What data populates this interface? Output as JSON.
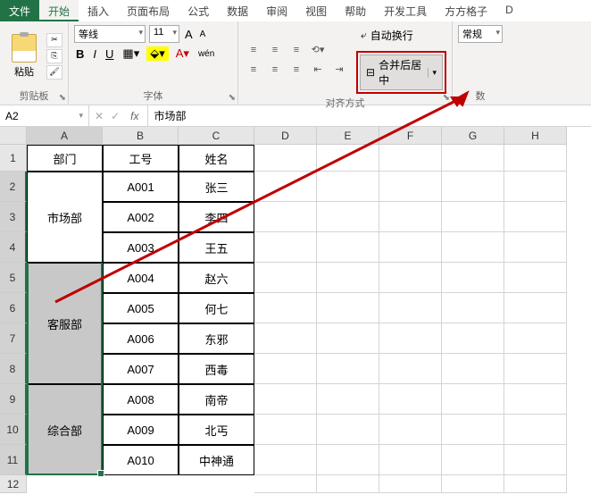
{
  "tabs": {
    "file": "文件",
    "home": "开始",
    "insert": "插入",
    "layout": "页面布局",
    "formula": "公式",
    "data": "数据",
    "review": "审阅",
    "view": "视图",
    "help": "帮助",
    "dev": "开发工具",
    "ffgz": "方方格子",
    "d": "D"
  },
  "clipboard": {
    "paste": "粘贴",
    "label": "剪贴板"
  },
  "font": {
    "name": "等线",
    "size": "11",
    "bold": "B",
    "italic": "I",
    "underline": "U",
    "wen": "wén",
    "aa_big": "A",
    "aa_small": "A",
    "label": "字体"
  },
  "align": {
    "wrap": "自动换行",
    "merge": "合并后居中",
    "label": "对齐方式"
  },
  "number": {
    "general": "常规",
    "label": "数"
  },
  "namebox": "A2",
  "formula_value": "市场部",
  "cols": [
    "A",
    "B",
    "C",
    "D",
    "E",
    "F",
    "G",
    "H"
  ],
  "rows": [
    "1",
    "2",
    "3",
    "4",
    "5",
    "6",
    "7",
    "8",
    "9",
    "10",
    "11",
    "12"
  ],
  "table": {
    "header": {
      "dept": "部门",
      "id": "工号",
      "name": "姓名"
    },
    "depts": [
      "市场部",
      "客服部",
      "综合部"
    ],
    "data": [
      {
        "id": "A001",
        "name": "张三"
      },
      {
        "id": "A002",
        "name": "李四"
      },
      {
        "id": "A003",
        "name": "王五"
      },
      {
        "id": "A004",
        "name": "赵六"
      },
      {
        "id": "A005",
        "name": "何七"
      },
      {
        "id": "A006",
        "name": "东邪"
      },
      {
        "id": "A007",
        "name": "西毒"
      },
      {
        "id": "A008",
        "name": "南帝"
      },
      {
        "id": "A009",
        "name": "北丐"
      },
      {
        "id": "A010",
        "name": "中神通"
      }
    ]
  }
}
